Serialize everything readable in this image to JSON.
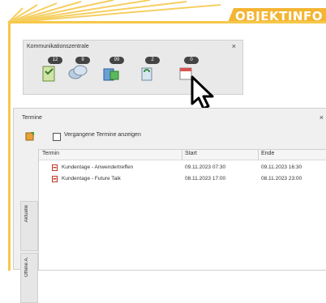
{
  "banner": {
    "text": "OBJEKTINFO"
  },
  "communication_panel": {
    "title": "Kommunikationszentrale",
    "close": "×",
    "items": [
      {
        "icon": "task-clipboard-icon",
        "count": "12"
      },
      {
        "icon": "chat-bubbles-icon",
        "count": "9"
      },
      {
        "icon": "contacts-icon",
        "count": "99"
      },
      {
        "icon": "recycle-bin-icon",
        "count": "2"
      },
      {
        "icon": "calendar-icon",
        "count": "0"
      }
    ]
  },
  "appointments_panel": {
    "title": "Termine",
    "close": "×",
    "show_past_label": "Vergangene Termine anzeigen",
    "side_tabs": [
      "Aktuelle",
      "Offene A."
    ],
    "columns": [
      "Termin",
      "Start",
      "Ende"
    ],
    "rows": [
      {
        "title": "Kundentage - Anwendertreffen",
        "start": "09.11.2023 07:30",
        "end": "09.11.2023 16:30"
      },
      {
        "title": "Kundentage - Future Talk",
        "start": "08.11.2023 17:00",
        "end": "08.11.2023 23:00"
      }
    ]
  },
  "colors": {
    "frame": "#f6c84a",
    "banner": "#f3b533"
  }
}
